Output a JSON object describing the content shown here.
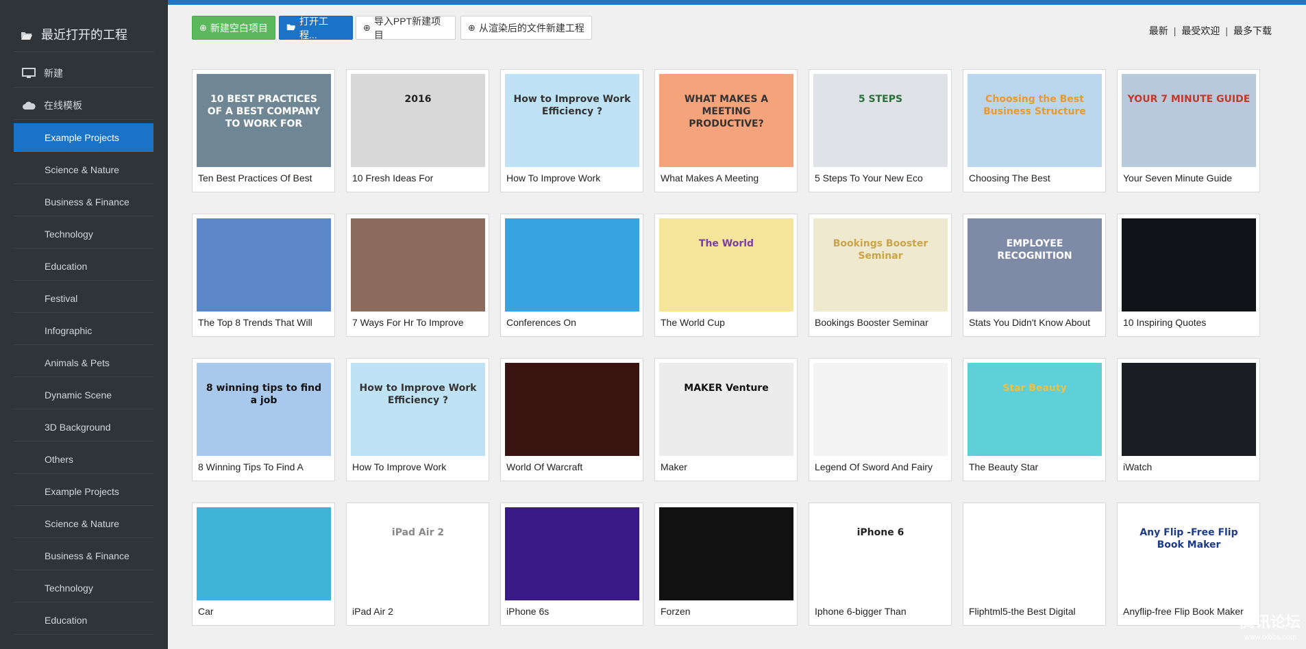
{
  "sidebar": {
    "title": "最近打开的工程",
    "items": [
      {
        "label": "新建",
        "icon": "monitor-icon",
        "type": "top"
      },
      {
        "label": "在线模板",
        "icon": "cloud-icon",
        "type": "top"
      },
      {
        "label": "Example Projects",
        "type": "sub",
        "active": true
      },
      {
        "label": "Science & Nature",
        "type": "sub"
      },
      {
        "label": "Business & Finance",
        "type": "sub"
      },
      {
        "label": "Technology",
        "type": "sub"
      },
      {
        "label": "Education",
        "type": "sub"
      },
      {
        "label": "Festival",
        "type": "sub"
      },
      {
        "label": "Infographic",
        "type": "sub"
      },
      {
        "label": "Animals & Pets",
        "type": "sub"
      },
      {
        "label": "Dynamic Scene",
        "type": "sub"
      },
      {
        "label": "3D Background",
        "type": "sub"
      },
      {
        "label": "Others",
        "type": "sub"
      },
      {
        "label": "Example Projects",
        "type": "sub"
      },
      {
        "label": "Science & Nature",
        "type": "sub"
      },
      {
        "label": "Business & Finance",
        "type": "sub"
      },
      {
        "label": "Technology",
        "type": "sub"
      },
      {
        "label": "Education",
        "type": "sub"
      }
    ]
  },
  "toolbar": {
    "new_blank": "新建空白项目",
    "open_project": "打开工程...",
    "import_ppt": "导入PPT新建项目",
    "from_render": "从渲染后的文件新建工程"
  },
  "sort": {
    "latest": "最新",
    "popular": "最受欢迎",
    "downloads": "最多下载"
  },
  "templates": [
    {
      "title": "Ten Best Practices Of Best",
      "thumb_text": "10 BEST PRACTICES OF A BEST COMPANY TO WORK FOR",
      "bg": "#6f8694",
      "fg": "#ffffff"
    },
    {
      "title": "10 Fresh Ideas For",
      "thumb_text": "2016",
      "bg": "#d8d8d8",
      "fg": "#222222"
    },
    {
      "title": "How To Improve Work",
      "thumb_text": "How to Improve Work Efficiency ?",
      "bg": "#bfe3f5",
      "fg": "#333333"
    },
    {
      "title": "What Makes A Meeting",
      "thumb_text": "WHAT MAKES A MEETING PRODUCTIVE?",
      "bg": "#f5a37a",
      "fg": "#333333"
    },
    {
      "title": "5 Steps To Your New Eco",
      "thumb_text": "5 STEPS",
      "bg": "#dfe3e8",
      "fg": "#2a6f3a"
    },
    {
      "title": "Choosing The Best",
      "thumb_text": "Choosing the Best Business Structure",
      "bg": "#bcd6ee",
      "fg": "#e89a2a"
    },
    {
      "title": "Your Seven Minute Guide",
      "thumb_text": "YOUR 7 MINUTE GUIDE",
      "bg": "#b9c9dc",
      "fg": "#c0392b"
    },
    {
      "title": "The Top 8 Trends That Will",
      "thumb_text": "",
      "bg": "#5b86c9",
      "fg": "#ffffff"
    },
    {
      "title": "7 Ways For Hr To Improve",
      "thumb_text": "",
      "bg": "#8a6b5c",
      "fg": "#ffffff"
    },
    {
      "title": "Conferences On",
      "thumb_text": "",
      "bg": "#37a3e0",
      "fg": "#ffffff"
    },
    {
      "title": "The World Cup",
      "thumb_text": "The World",
      "bg": "#f4e59a",
      "fg": "#7b3fa0"
    },
    {
      "title": "Bookings Booster Seminar",
      "thumb_text": "Bookings Booster Seminar",
      "bg": "#efe9cf",
      "fg": "#c9a44a"
    },
    {
      "title": "Stats You Didn't Know About",
      "thumb_text": "EMPLOYEE RECOGNITION",
      "bg": "#7f8aa7",
      "fg": "#ffffff"
    },
    {
      "title": "10 Inspiring Quotes",
      "thumb_text": "",
      "bg": "#121318",
      "fg": "#ffffff"
    },
    {
      "title": "8 Winning Tips To Find A",
      "thumb_text": "8 winning tips to find a job",
      "bg": "#a8c8ec",
      "fg": "#111111"
    },
    {
      "title": "How To Improve Work",
      "thumb_text": "How to Improve Work Efficiency ?",
      "bg": "#bfe3f5",
      "fg": "#333333"
    },
    {
      "title": "World Of Warcraft",
      "thumb_text": "",
      "bg": "#3a1410",
      "fg": "#ffffff"
    },
    {
      "title": "Maker",
      "thumb_text": "MAKER Venture",
      "bg": "#ececec",
      "fg": "#111111"
    },
    {
      "title": "Legend Of Sword And Fairy",
      "thumb_text": "",
      "bg": "#f4f4f4",
      "fg": "#555555"
    },
    {
      "title": "The Beauty Star",
      "thumb_text": "Star Beauty",
      "bg": "#5fcfd8",
      "fg": "#f0c040"
    },
    {
      "title": "iWatch",
      "thumb_text": "",
      "bg": "#1b1d22",
      "fg": "#ffffff"
    },
    {
      "title": "Car",
      "thumb_text": "",
      "bg": "#3fb4d6",
      "fg": "#ffffff"
    },
    {
      "title": "iPad Air 2",
      "thumb_text": "iPad Air 2",
      "bg": "#ffffff",
      "fg": "#888888"
    },
    {
      "title": "iPhone 6s",
      "thumb_text": "",
      "bg": "#3a1a86",
      "fg": "#ffffff"
    },
    {
      "title": "Forzen",
      "thumb_text": "",
      "bg": "#111111",
      "fg": "#ffffff"
    },
    {
      "title": "Iphone 6-bigger Than",
      "thumb_text": "iPhone 6",
      "bg": "#ffffff",
      "fg": "#222222"
    },
    {
      "title": "Fliphtml5-the Best Digital",
      "thumb_text": "",
      "bg": "#ffffff",
      "fg": "#333333"
    },
    {
      "title": "Anyflip-free Flip Book Maker",
      "thumb_text": "Any Flip -Free Flip Book Maker",
      "bg": "#ffffff",
      "fg": "#1a3a8a"
    }
  ],
  "watermark": {
    "main": "腾讯论坛",
    "sub": "www.txbbs.com"
  },
  "colors": {
    "sidebar": "#2f3439",
    "accent": "#1a73c7",
    "green": "#5cb85c"
  }
}
